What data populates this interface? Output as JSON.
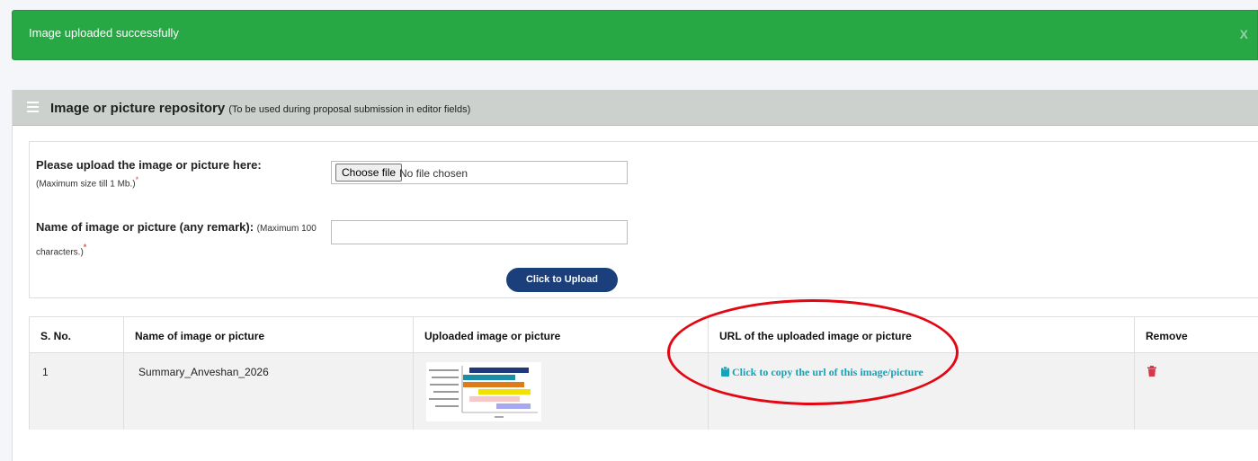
{
  "alert": {
    "message": "Image uploaded successfully",
    "close_label": "X"
  },
  "panel": {
    "title": "Image or picture repository",
    "subtitle": "(To be used during proposal submission in editor fields)"
  },
  "form": {
    "upload_label": "Please upload the image or picture here:",
    "upload_hint": "(Maximum size till 1 Mb.)",
    "required_mark": "*",
    "file_button": "Choose file",
    "file_status": "No file chosen",
    "name_label": "Name of image or picture (any remark):",
    "name_hint": "(Maximum 100 characters.)",
    "name_value": "",
    "submit_label": "Click to Upload"
  },
  "table": {
    "headers": [
      "S. No.",
      "Name of image or picture",
      "Uploaded image or picture",
      "URL of the uploaded image or picture",
      "Remove"
    ],
    "rows": [
      {
        "sno": "1",
        "name": "Summary_Anveshan_2026",
        "copy_label": "Click to copy the url of this image/picture"
      }
    ]
  },
  "colors": {
    "success": "#28a745",
    "primary": "#1b3f7a",
    "link": "#17a2b8",
    "danger": "#dc3545",
    "annotation": "#e30613"
  },
  "icons": {
    "menu": "hamburger-icon",
    "clipboard": "clipboard-icon",
    "trash": "trash-icon"
  }
}
